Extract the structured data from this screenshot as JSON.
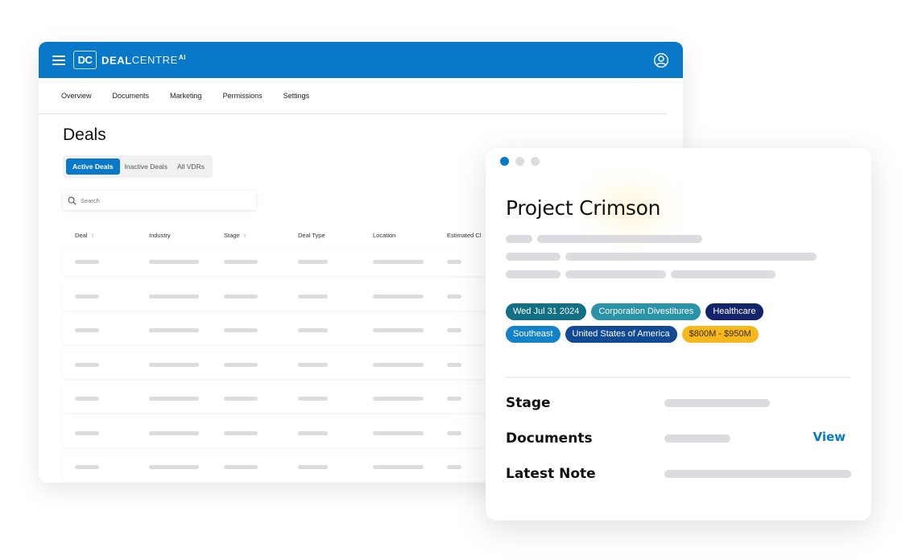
{
  "app": {
    "logo_mark": "DC",
    "brand_bold": "DEAL",
    "brand_light": "CENTRE",
    "brand_sup": "AI",
    "icons": {
      "menu": "hamburger-icon",
      "user": "user-circle-icon",
      "search": "search-icon"
    },
    "colors": {
      "primary": "#0a78c8",
      "skeleton": "#dcdcde"
    }
  },
  "nav": {
    "items": [
      {
        "label": "Overview"
      },
      {
        "label": "Documents"
      },
      {
        "label": "Marketing"
      },
      {
        "label": "Permissions"
      },
      {
        "label": "Settings"
      }
    ]
  },
  "deals": {
    "title": "Deals",
    "tabs": [
      {
        "label": "Active Deals",
        "active": true
      },
      {
        "label": "Inactive Deals",
        "active": false
      },
      {
        "label": "All VDRs",
        "active": false
      }
    ],
    "search": {
      "placeholder": "Search",
      "value": ""
    },
    "columns": [
      {
        "label": "Deal",
        "sortable": true
      },
      {
        "label": "Industry",
        "sortable": false
      },
      {
        "label": "Stage",
        "sortable": true
      },
      {
        "label": "Deal Type",
        "sortable": false
      },
      {
        "label": "Location",
        "sortable": false
      },
      {
        "label": "Estimated Cl",
        "sortable": false
      }
    ],
    "row_count": 7
  },
  "card": {
    "pager": {
      "pages": 3,
      "active": 1
    },
    "title": "Project Crimson",
    "tags": [
      [
        {
          "label": "Wed Jul 31 2024",
          "color": "#136f84"
        },
        {
          "label": "Corporation Divestitures",
          "color": "#2a93a8"
        },
        {
          "label": "Healthcare",
          "color": "#14246b"
        }
      ],
      [
        {
          "label": "Southeast",
          "color": "#1382c9"
        },
        {
          "label": "United States of America",
          "color": "#114a93"
        },
        {
          "label": "$800M - $950M",
          "color": "#f6b91d",
          "text_color": "#3a2a00"
        }
      ]
    ],
    "properties": [
      {
        "label": "Stage"
      },
      {
        "label": "Documents",
        "action": "View"
      },
      {
        "label": "Latest Note"
      }
    ]
  }
}
